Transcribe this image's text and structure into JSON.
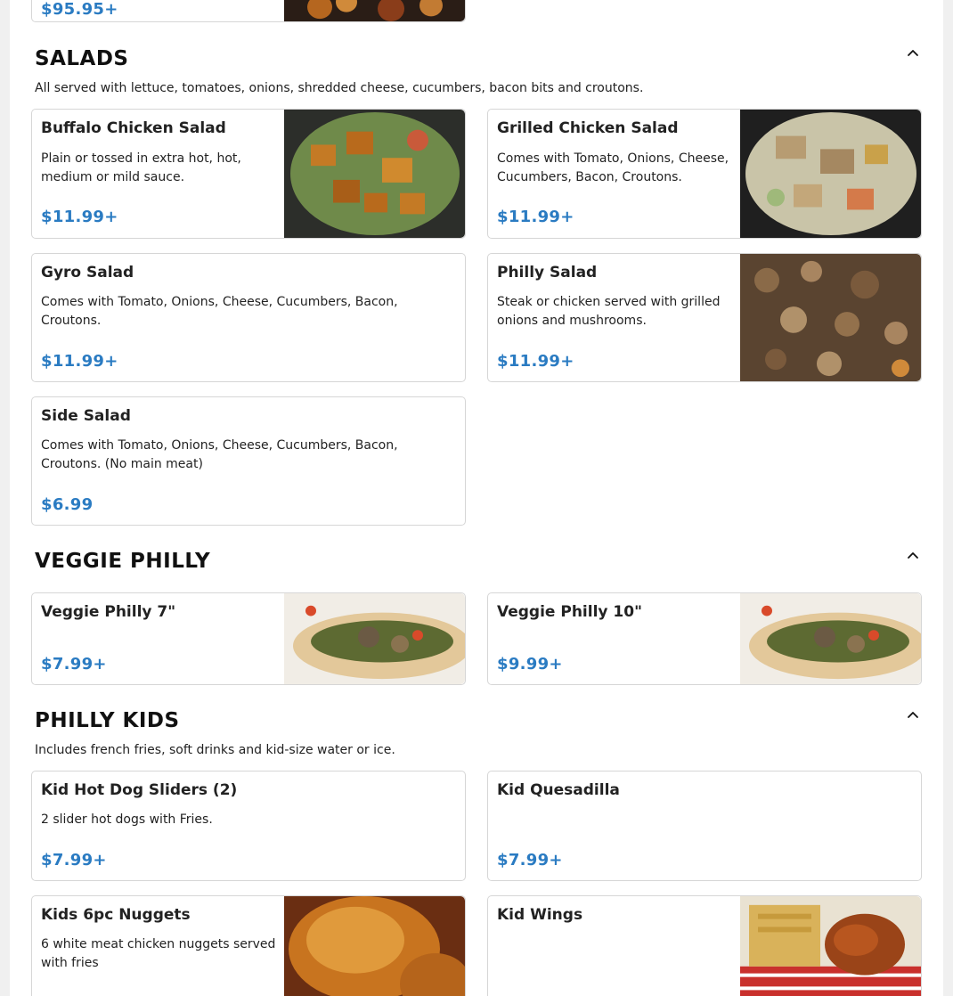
{
  "top_card": {
    "price": "$95.95+"
  },
  "salads": {
    "title": "SALADS",
    "description": "All served with lettuce, tomatoes, onions, shredded cheese, cucumbers, bacon bits and croutons.",
    "items": [
      {
        "name": "Buffalo Chicken Salad",
        "description": "Plain or tossed in extra hot, hot, medium or mild sauce.",
        "price": "$11.99+"
      },
      {
        "name": "Grilled Chicken Salad",
        "description": "Comes with Tomato, Onions, Cheese, Cucumbers, Bacon, Croutons.",
        "price": "$11.99+"
      },
      {
        "name": "Gyro Salad",
        "description": "Comes with Tomato, Onions, Cheese, Cucumbers, Bacon, Croutons.",
        "price": "$11.99+"
      },
      {
        "name": "Philly Salad",
        "description": "Steak or chicken served with grilled onions and mushrooms.",
        "price": "$11.99+"
      },
      {
        "name": "Side Salad",
        "description": "Comes with Tomato, Onions, Cheese, Cucumbers, Bacon, Croutons. (No main meat)",
        "price": "$6.99"
      }
    ]
  },
  "veggie_philly": {
    "title": "VEGGIE PHILLY",
    "items": [
      {
        "name": "Veggie Philly 7\"",
        "price": "$7.99+"
      },
      {
        "name": "Veggie Philly 10\"",
        "price": "$9.99+"
      }
    ]
  },
  "philly_kids": {
    "title": "PHILLY KIDS",
    "description": "Includes french fries, soft drinks and kid-size water or ice.",
    "items": [
      {
        "name": "Kid Hot Dog Sliders (2)",
        "description": "2 slider hot dogs with Fries.",
        "price": "$7.99+"
      },
      {
        "name": "Kid Quesadilla",
        "price": "$7.99+"
      },
      {
        "name": "Kids 6pc Nuggets",
        "description": "6 white meat chicken nuggets served with fries"
      },
      {
        "name": "Kid Wings"
      }
    ]
  },
  "colors": {
    "price": "#2a7bc2",
    "card_border": "#d6d6d6"
  },
  "icons": {
    "collapse": "chevron-up-icon"
  }
}
